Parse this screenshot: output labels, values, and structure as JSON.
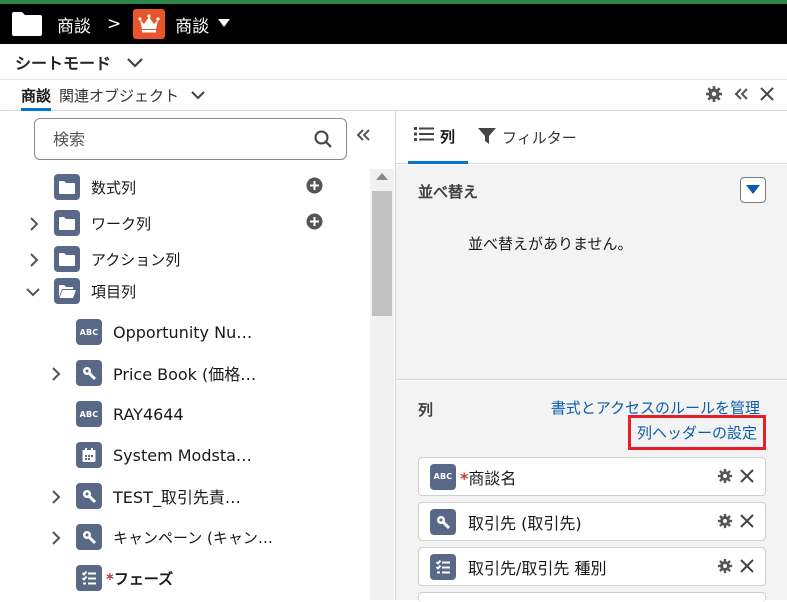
{
  "colors": {
    "top_accent": "#2e844a",
    "topbar_bg": "#000000",
    "app_icon_bg": "#e8552c",
    "tab_underline": "#0176d3",
    "object_icon_bg": "#5a6887",
    "link": "#0b5cab",
    "highlight_box": "#e5202a",
    "required": "#c23934"
  },
  "topbar": {
    "breadcrumb_1": "商談",
    "separator": ">",
    "breadcrumb_2": "商談",
    "icons": [
      "folder-icon",
      "crown-icon",
      "caret-down-icon"
    ]
  },
  "mode": {
    "title": "シートモード"
  },
  "tabs": {
    "active": "商談",
    "other": "関連オブジェクト",
    "icons": [
      "gear-icon",
      "double-chevron-left-icon",
      "close-icon"
    ]
  },
  "left": {
    "search_placeholder": "検索",
    "tree": [
      {
        "label": "数式列",
        "icon": "folder-icon",
        "expandable": false,
        "add": true
      },
      {
        "label": "ワーク列",
        "icon": "folder-icon",
        "expandable": true,
        "add": true
      },
      {
        "label": "アクション列",
        "icon": "folder-icon",
        "expandable": true,
        "add": false
      },
      {
        "label": "項目列",
        "icon": "folder-open-icon",
        "expanded": true
      },
      {
        "label": "Opportunity Nu…",
        "icon": "abc-text-icon"
      },
      {
        "label": "Price Book (価格…",
        "icon": "lookup-icon",
        "expandable": true
      },
      {
        "label": "RAY4644",
        "icon": "abc-text-icon"
      },
      {
        "label": "System Modsta…",
        "icon": "calendar-icon"
      },
      {
        "label": "TEST_取引先責…",
        "icon": "lookup-icon",
        "expandable": true
      },
      {
        "label": "キャンペーン (キャン…",
        "icon": "lookup-icon",
        "expandable": true
      },
      {
        "label": "フェーズ",
        "icon": "picklist-icon",
        "required": true
      }
    ]
  },
  "right": {
    "tab_columns": "列",
    "tab_filter": "フィルター",
    "sort_title": "並べ替え",
    "sort_empty": "並べ替えがありません。",
    "columns_title": "列",
    "manage_link": "書式とアクセスのルールを管理",
    "header_settings_link": "列ヘッダーの設定",
    "columns": [
      {
        "label": "商談名",
        "icon": "abc-text-icon",
        "required": true
      },
      {
        "label": "取引先 (取引先)",
        "icon": "lookup-icon",
        "required": false
      },
      {
        "label": "取引先/取引先 種別",
        "icon": "picklist-icon",
        "required": false
      }
    ],
    "abc_text": "ABC",
    "required_mark": "*"
  }
}
